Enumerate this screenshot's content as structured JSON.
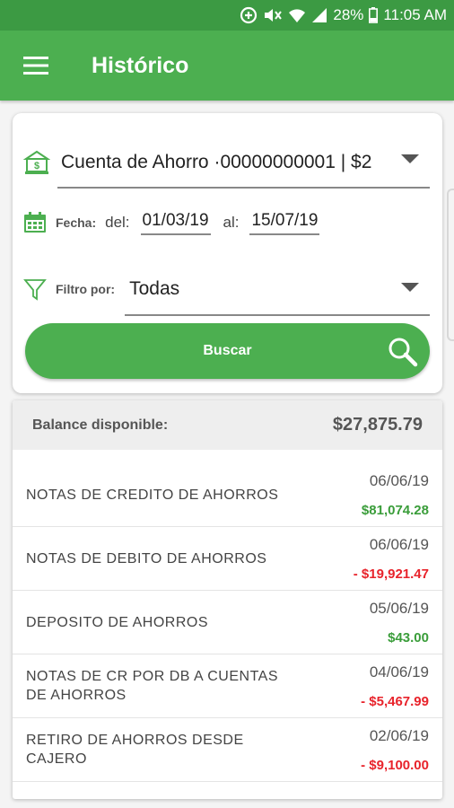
{
  "status_bar": {
    "battery": "28%",
    "time": "11:05 AM",
    "icons": [
      "data-saver-icon",
      "mute-icon",
      "wifi-icon",
      "signal-icon",
      "battery-icon"
    ]
  },
  "app_bar": {
    "title": "Histórico",
    "menu_icon": "hamburger-menu-icon",
    "color": "#4caf50"
  },
  "filters": {
    "account": "Cuenta de Ahorro ·00000000001  | $2",
    "date_label": "Fecha:",
    "from_label": "del:",
    "from_date": "01/03/19",
    "to_label": "al:",
    "to_date": "15/07/19",
    "filter_label": "Filtro por:",
    "filter_value": "Todas",
    "search_button": "Buscar"
  },
  "balance": {
    "label": "Balance disponible:",
    "value": "$27,875.79"
  },
  "transactions": [
    {
      "description": "NOTAS DE CREDITO DE AHORROS",
      "date": "06/06/19",
      "amount": "$81,074.28",
      "type": "credit"
    },
    {
      "description": "NOTAS DE DEBITO DE AHORROS",
      "date": "06/06/19",
      "amount": "-  $19,921.47",
      "type": "debit"
    },
    {
      "description": "DEPOSITO DE AHORROS",
      "date": "05/06/19",
      "amount": "$43.00",
      "type": "credit"
    },
    {
      "description": "NOTAS DE CR POR DB A CUENTAS DE AHORROS",
      "date": "04/06/19",
      "amount": "-  $5,467.99",
      "type": "debit"
    },
    {
      "description": "RETIRO DE AHORROS DESDE CAJERO",
      "date": "02/06/19",
      "amount": "-  $9,100.00",
      "type": "debit"
    }
  ],
  "colors": {
    "primary": "#4caf50",
    "credit": "#3a9d3a",
    "debit": "#e8232b"
  }
}
